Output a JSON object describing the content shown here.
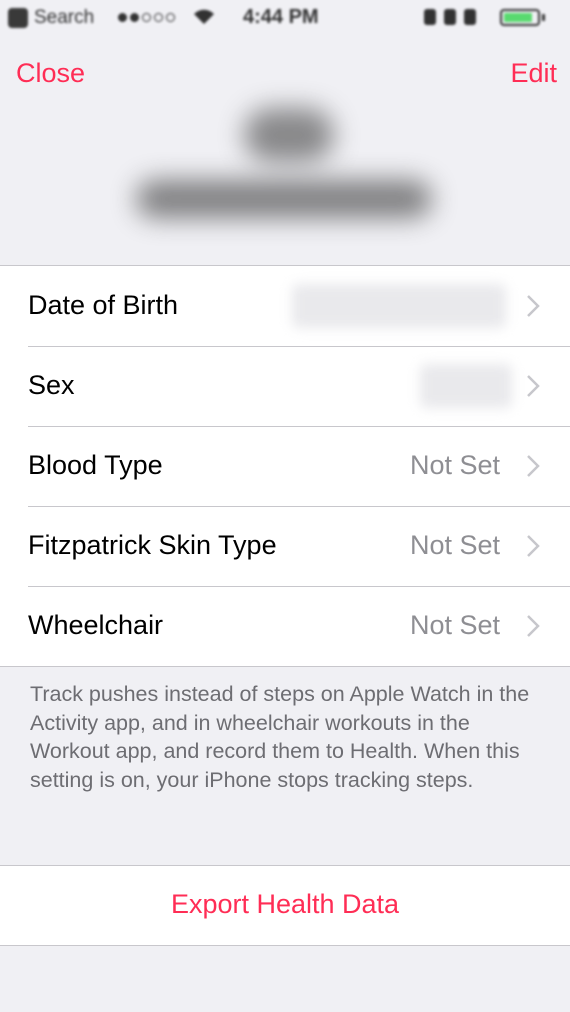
{
  "status_bar": {
    "back_label": "Search",
    "time": "4:44 PM"
  },
  "nav": {
    "close_label": "Close",
    "edit_label": "Edit"
  },
  "rows": [
    {
      "label": "Date of Birth",
      "value": ""
    },
    {
      "label": "Sex",
      "value": ""
    },
    {
      "label": "Blood Type",
      "value": "Not Set"
    },
    {
      "label": "Fitzpatrick Skin Type",
      "value": "Not Set"
    },
    {
      "label": "Wheelchair",
      "value": "Not Set"
    }
  ],
  "footer_note": "Track pushes instead of steps on Apple Watch in the Activity app, and in wheelchair workouts in the Workout app, and record them to Health. When this setting is on, your iPhone stops tracking steps.",
  "export_label": "Export Health Data",
  "colors": {
    "accent": "#ff2d55",
    "secondary_text": "#8e8e93",
    "footer_text": "#6d6d72",
    "background": "#f0f0f4",
    "separator": "#c8c7cc"
  },
  "icons": [
    "chevron-right-icon",
    "wifi-icon",
    "battery-icon"
  ]
}
